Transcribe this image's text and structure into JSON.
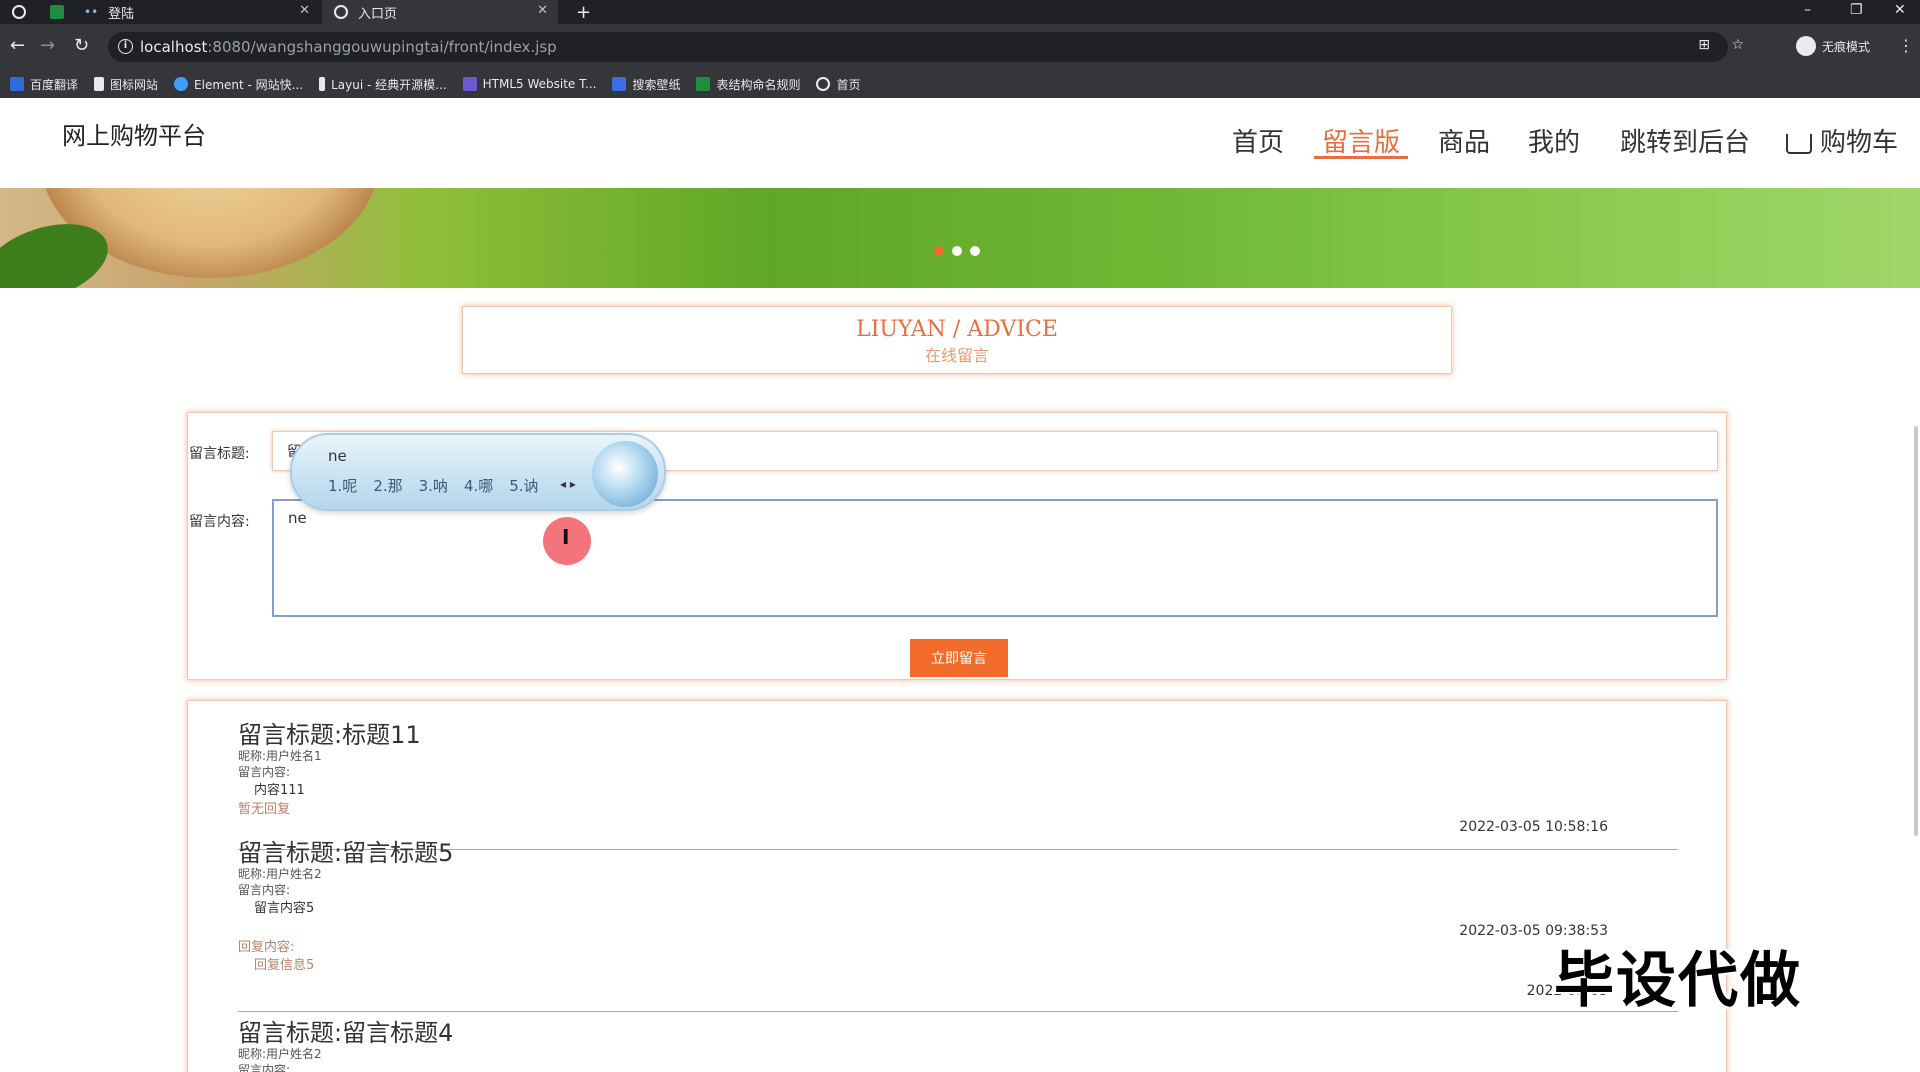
{
  "browser": {
    "tabs": [
      {
        "label": ""
      },
      {
        "label": ""
      },
      {
        "label": "登陆"
      },
      {
        "label": "入口页"
      }
    ],
    "new_tab": "+",
    "url_host": "localhost",
    "url_rest": ":8080/wangshanggouwupingtai/front/index.jsp",
    "incognito_label": "无痕模式",
    "bookmarks": [
      {
        "label": "百度翻译",
        "color": "#2f6bdb"
      },
      {
        "label": "图标网站",
        "color": "#e8eaed"
      },
      {
        "label": "Element - 网站快...",
        "color": "#409eff"
      },
      {
        "label": "Layui - 经典开源模...",
        "color": "#e8eaed"
      },
      {
        "label": "HTML5 Website T...",
        "color": "#6a5acd"
      },
      {
        "label": "搜索壁纸",
        "color": "#3b6ee8"
      },
      {
        "label": "表结构命名规则",
        "color": "#1e8e3e"
      },
      {
        "label": "首页",
        "color": "#e8eaed"
      }
    ]
  },
  "site": {
    "title": "网上购物平台",
    "nav": [
      {
        "label": "首页",
        "active": false
      },
      {
        "label": "留言版",
        "active": true
      },
      {
        "label": "商品",
        "active": false
      },
      {
        "label": "我的",
        "active": false
      },
      {
        "label": "跳转到后台",
        "active": false
      },
      {
        "label": "购物车",
        "active": false
      }
    ],
    "accent": "#e66f3d"
  },
  "section": {
    "title_en": "LIUYAN / ADVICE",
    "title_cn": "在线留言"
  },
  "form": {
    "title_label": "留言标题:",
    "title_value": "留言111",
    "content_label": "留言内容:",
    "content_value": "ne",
    "submit_label": "立即留言"
  },
  "ime": {
    "composition": "ne",
    "candidates": [
      "1.呢",
      "2.那",
      "3.呐",
      "4.哪",
      "5.讷"
    ]
  },
  "messages": [
    {
      "title": "留言标题:标题11",
      "nickname": "昵称:用户姓名1",
      "content_label": "留言内容:",
      "content": "内容111",
      "reply_label": "暂无回复",
      "reply": "",
      "time": "2022-03-05 10:58:16"
    },
    {
      "title": "留言标题:留言标题5",
      "nickname": "昵称:用户姓名2",
      "content_label": "留言内容:",
      "content": "留言内容5",
      "reply_label": "回复内容:",
      "reply": "回复信息5",
      "time": "2022-03-05 09:38:53",
      "time2": "2022-03-05"
    },
    {
      "title": "留言标题:留言标题4",
      "nickname": "昵称:用户姓名2",
      "content_label": "留言内容:"
    }
  ],
  "watermark": "毕设代做"
}
